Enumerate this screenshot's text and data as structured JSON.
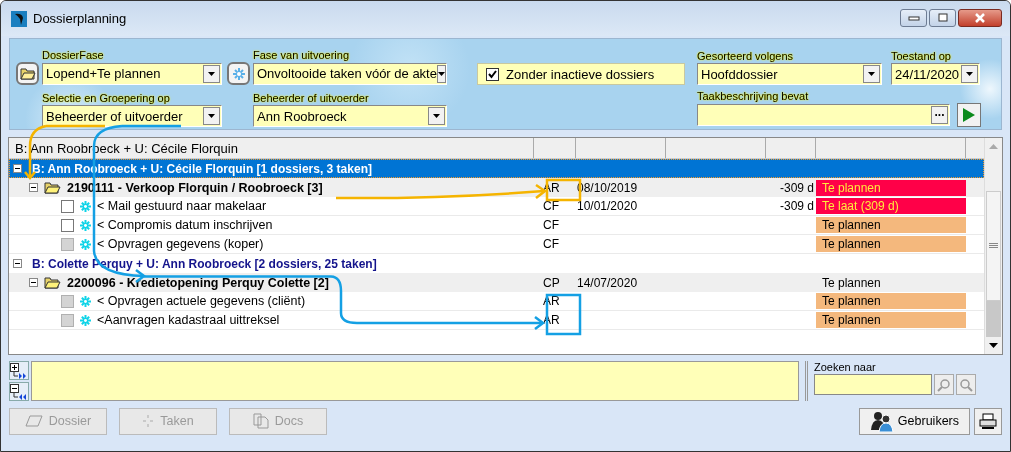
{
  "window": {
    "title": "Dossierplanning"
  },
  "filters": {
    "dossier_phase": {
      "label": "DossierFase",
      "value": "Lopend+Te plannen"
    },
    "execution_phase": {
      "label": "Fase van uitvoering",
      "value": "Onvoltooide taken vóór de akte"
    },
    "inactive": {
      "label": "Zonder inactieve dossiers",
      "checked": true
    },
    "sorted_by": {
      "label": "Gesorteerd volgens",
      "value": "Hoofddossier"
    },
    "state_on": {
      "label": "Toestand op",
      "value": "24/11/2020"
    },
    "grouping": {
      "label": "Selectie en Groepering op",
      "value": "Beheerder of uitvoerder"
    },
    "manager": {
      "label": "Beheerder of uitvoerder",
      "value": "Ann Roobroeck"
    },
    "task_text": {
      "label": "Taakbeschrijving bevat",
      "browse": "..."
    }
  },
  "grid": {
    "header": "B: Ann Roobroeck + U: Cécile Florquin",
    "groups": [
      {
        "label": "B: Ann Roobroeck + U: Cécile Florquin [1 dossiers, 3 taken]",
        "selected": true,
        "expanded": true,
        "dossiers": [
          {
            "label": "2190111 - Verkoop Florquin / Roobroeck [3]",
            "expanded": true,
            "initials": "AR",
            "date": "08/10/2019",
            "days": "-309 d",
            "status": "Te plannen",
            "color": "#ff0048",
            "tasks": [
              {
                "label": "< Mail gestuurd naar makelaar",
                "checked": false,
                "disabled": false,
                "initials": "CF",
                "date": "10/01/2020",
                "days": "-309 d",
                "status": "Te laat (309 d)",
                "color": "#ff0048"
              },
              {
                "label": "< Compromis datum inschrijven",
                "checked": false,
                "disabled": false,
                "initials": "CF",
                "status": "Te plannen",
                "color": "#f4b87d"
              },
              {
                "label": "< Opvragen gegevens (koper)",
                "checked": false,
                "disabled": true,
                "initials": "CF",
                "status": "Te plannen",
                "color": "#f4b87d"
              }
            ]
          }
        ]
      },
      {
        "label": "B: Colette Perquy + U: Ann Roobroeck [2 dossiers, 25 taken]",
        "selected": false,
        "expanded": true,
        "dossiers": [
          {
            "label": "2200096 - Kredietopening Perquy Colette [2]",
            "expanded": true,
            "initials": "CP",
            "date": "14/07/2020",
            "status": "Te plannen",
            "tasks": [
              {
                "label": "< Opvragen actuele gegevens (cliënt)",
                "checked": false,
                "disabled": true,
                "initials": "AR",
                "status": "Te plannen",
                "color": "#f4b87d"
              },
              {
                "label": "<Aanvragen kadastraal uittreksel",
                "checked": false,
                "disabled": true,
                "initials": "AR",
                "status": "Te plannen",
                "color": "#f4b87d"
              }
            ]
          }
        ]
      }
    ]
  },
  "search": {
    "label": "Zoeken naar"
  },
  "buttons": [
    {
      "kind": "dossier",
      "label": "Dossier",
      "disabled": true
    },
    {
      "kind": "tasks",
      "label": "Taken",
      "disabled": true
    },
    {
      "kind": "docs",
      "label": "Docs",
      "disabled": true
    },
    {
      "kind": "users",
      "label": "Gebruikers",
      "disabled": false
    }
  ]
}
